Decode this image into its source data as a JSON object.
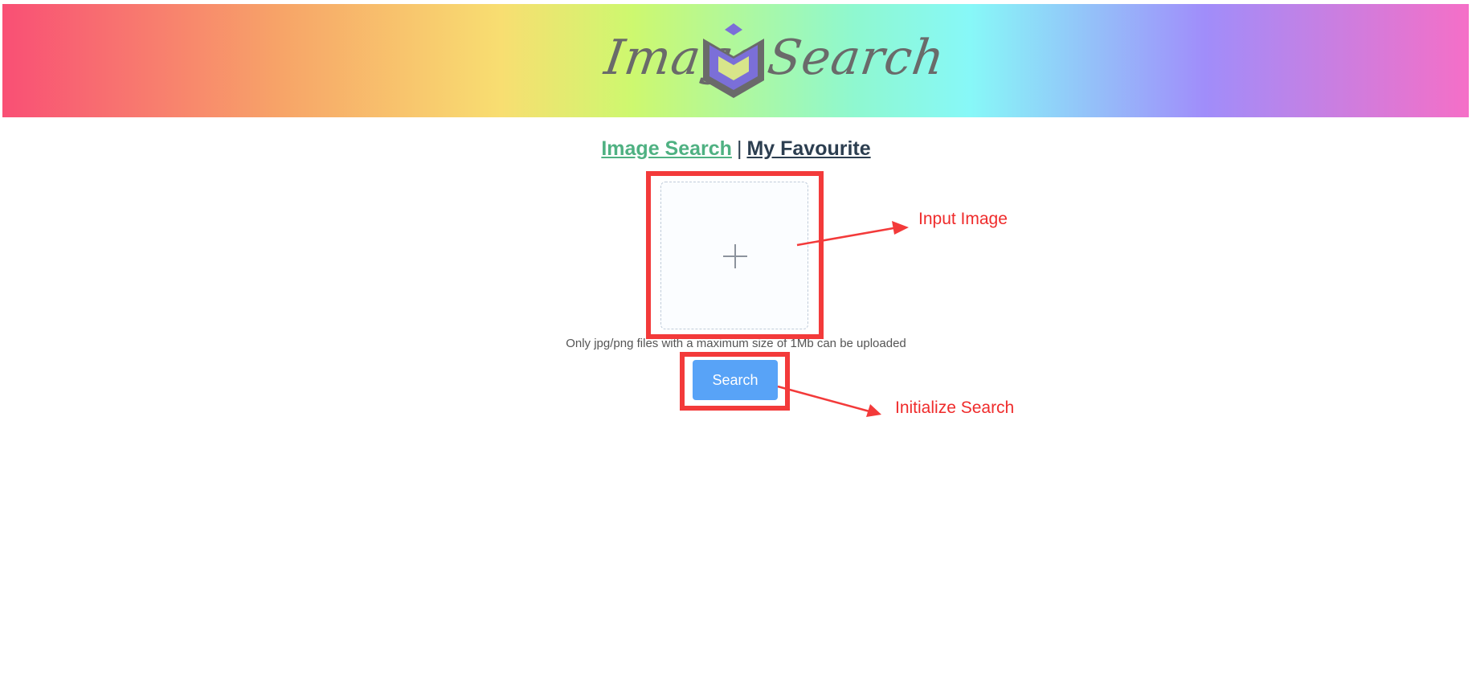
{
  "header": {
    "logo": {
      "text_left": "Image",
      "text_right": "Search",
      "icon": "cube-logo-icon"
    }
  },
  "nav": {
    "image_search": "Image Search",
    "separator": "|",
    "favourite": "My Favourite"
  },
  "upload": {
    "icon": "plus-icon",
    "hint": "Only jpg/png files with a maximum size of 1Mb can be uploaded"
  },
  "search": {
    "label": "Search"
  },
  "annotations": {
    "input_image": "Input Image",
    "initialize_search": "Initialize Search"
  },
  "colors": {
    "nav_active": "#4fb182",
    "nav_link": "#2c3e50",
    "button": "#58a3f7",
    "annotation": "#f33a3a",
    "logo_purple": "#7b6fd8",
    "logo_gray": "#6a6a6a"
  }
}
